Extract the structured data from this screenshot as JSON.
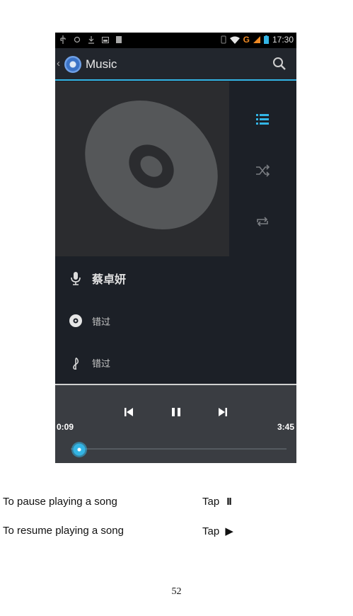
{
  "status_bar": {
    "time": "17:30",
    "network": "G"
  },
  "header": {
    "title": "Music"
  },
  "track": {
    "artist": "蔡卓妍",
    "album": "错过",
    "song": "错过"
  },
  "player": {
    "elapsed": "0:09",
    "duration": "3:45",
    "progress": 0.04
  },
  "instructions": [
    {
      "action": "To pause playing a song",
      "tap_label": "Tap",
      "symbol": "II"
    },
    {
      "action": "To resume playing a song",
      "tap_label": "Tap",
      "symbol": "▶"
    }
  ],
  "page_number": "52",
  "colors": {
    "accent": "#33b5e5",
    "screen_bg": "#1c2027",
    "player_bg": "#3a3d42"
  }
}
